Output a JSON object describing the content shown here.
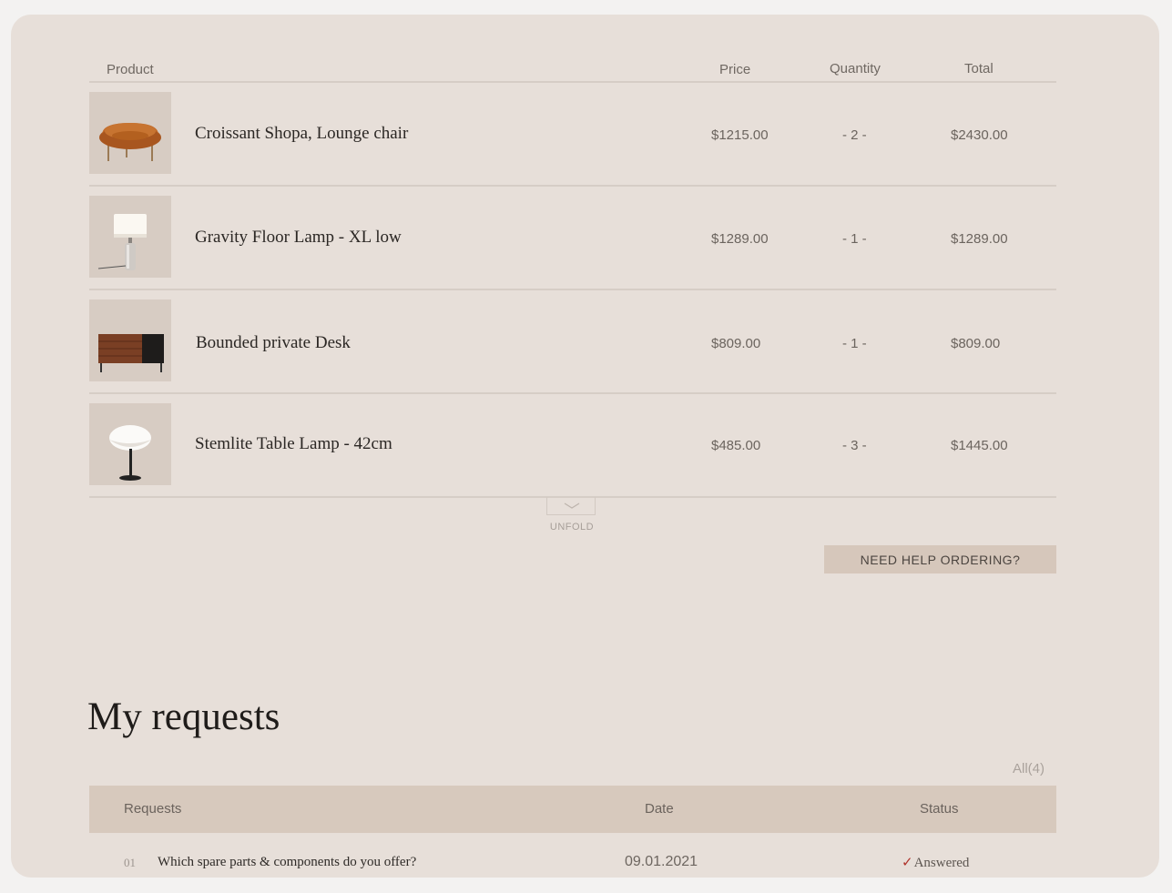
{
  "cart": {
    "headers": {
      "product": "Product",
      "price": "Price",
      "quantity": "Quantity",
      "total": "Total"
    },
    "items": [
      {
        "name": "Croissant Shopa, Lounge chair",
        "price": "$1215.00",
        "quantity": "- 2 -",
        "total": "$2430.00",
        "image": "lounge-chair"
      },
      {
        "name": "Gravity Floor Lamp - XL low",
        "price": "$1289.00",
        "quantity": "- 1 -",
        "total": "$1289.00",
        "image": "floor-lamp"
      },
      {
        "name": "Bounded private Desk",
        "price": "$809.00",
        "quantity": "- 1 -",
        "total": "$809.00",
        "image": "desk"
      },
      {
        "name": "Stemlite Table Lamp - 42cm",
        "price": "$485.00",
        "quantity": "- 3 -",
        "total": "$1445.00",
        "image": "table-lamp"
      }
    ],
    "unfold_label": "UNFOLD",
    "unfold_icon": "chevron-down-icon",
    "help_button": "NEED HELP ORDERING?"
  },
  "requests": {
    "title": "My requests",
    "all_link": "All(4)",
    "headers": {
      "requests": "Requests",
      "date": "Date",
      "status": "Status"
    },
    "rows": [
      {
        "index": "01",
        "question": "Which spare parts & components do you offer?",
        "date": "09.01.2021",
        "status": "Answered",
        "status_icon": "checkmark-icon"
      }
    ]
  },
  "colors": {
    "background": "#e7dfd9",
    "accent": "#d7c9bd",
    "check": "#b0332b"
  }
}
